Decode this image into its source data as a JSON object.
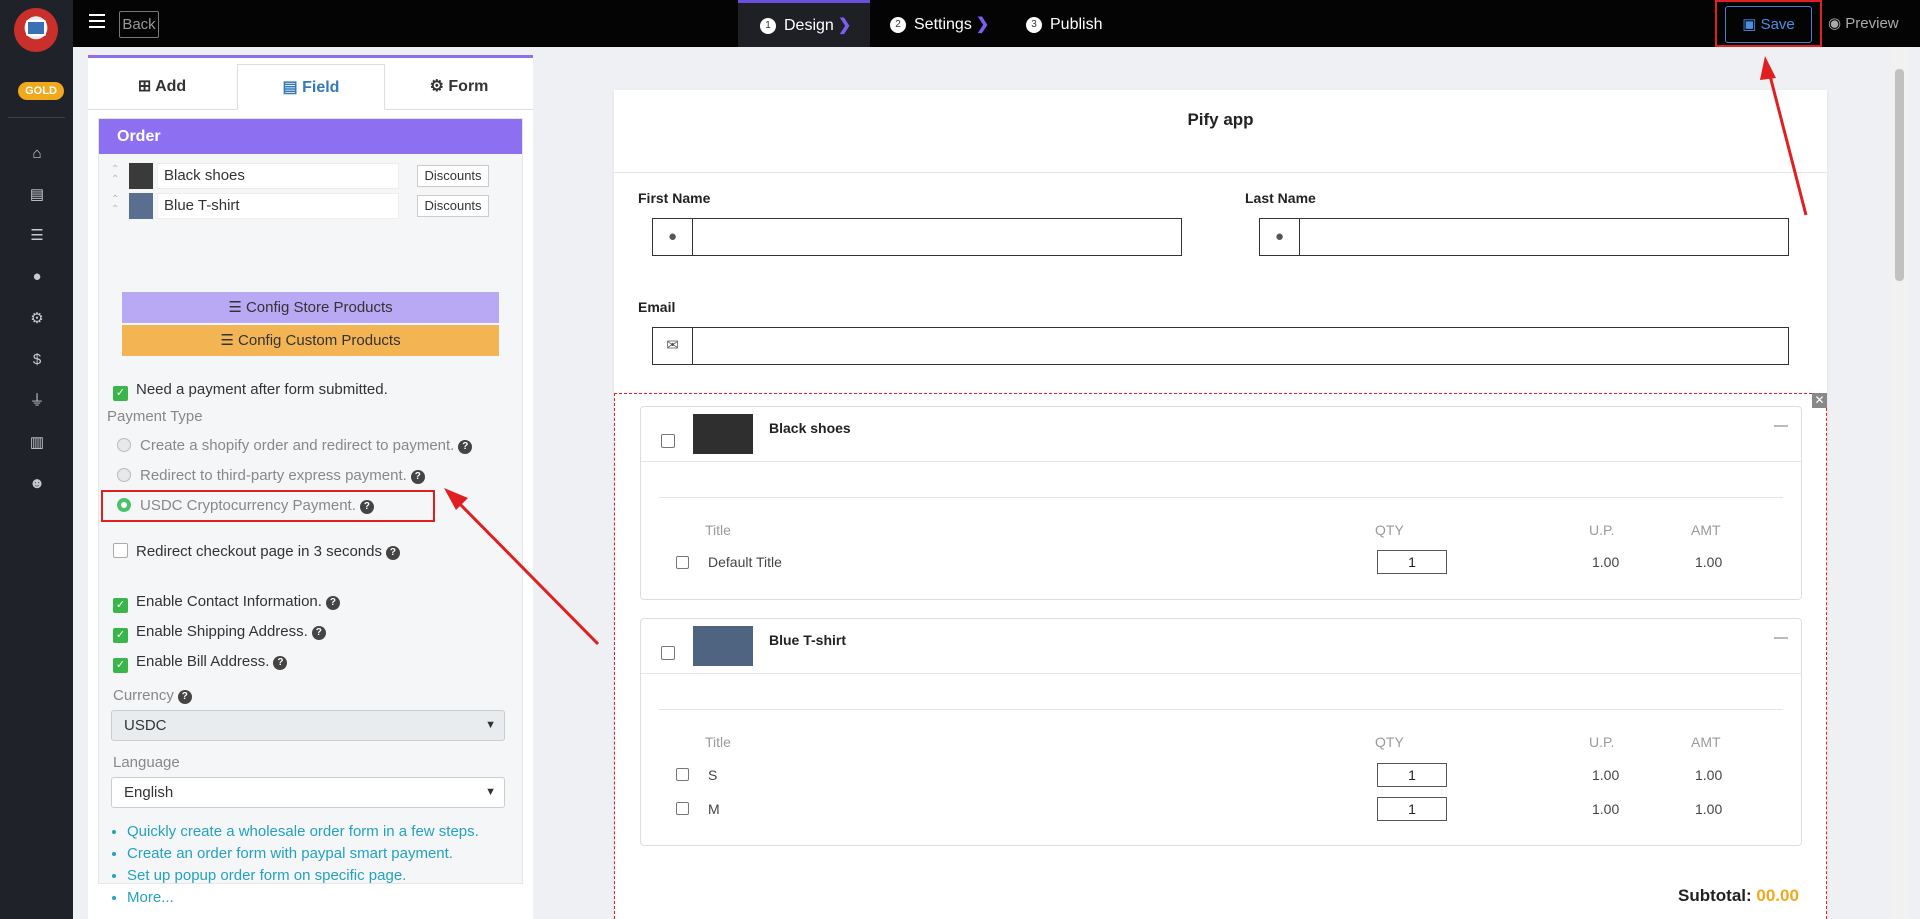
{
  "topbar": {
    "back_label": "Back",
    "steps": [
      {
        "num": "1",
        "label": "Design"
      },
      {
        "num": "2",
        "label": "Settings"
      },
      {
        "num": "3",
        "label": "Publish"
      }
    ],
    "save_label": "Save",
    "preview_label": "Preview"
  },
  "rail": {
    "badge": "GOLD"
  },
  "panel": {
    "tabs": {
      "add": "Add",
      "field": "Field",
      "form": "Form"
    },
    "section_title": "Order",
    "products": [
      {
        "name": "Black shoes",
        "discounts": "Discounts"
      },
      {
        "name": "Blue T-shirt",
        "discounts": "Discounts"
      }
    ],
    "config_store": "Config Store Products",
    "config_custom": "Config Custom Products",
    "need_payment": "Need a payment after form submitted.",
    "payment_type_label": "Payment Type",
    "payment_options": [
      {
        "label": "Create a shopify order and redirect to payment."
      },
      {
        "label": "Redirect to third-party express payment."
      },
      {
        "label": "USDC Cryptocurrency Payment."
      }
    ],
    "redirect_checkout": "Redirect checkout page in 3 seconds",
    "enable_contact": "Enable Contact Information.",
    "enable_shipping": "Enable Shipping Address.",
    "enable_bill": "Enable Bill Address.",
    "currency_label": "Currency",
    "currency_value": "USDC",
    "language_label": "Language",
    "language_value": "English",
    "links": [
      "Quickly create a wholesale order form in a few steps.",
      "Create an order form with paypal smart payment.",
      "Set up popup order form on specific page.",
      "More..."
    ]
  },
  "form": {
    "title": "Pify app",
    "first_name": "First Name",
    "last_name": "Last Name",
    "email": "Email",
    "columns": {
      "title": "Title",
      "qty": "QTY",
      "up": "U.P.",
      "amt": "AMT"
    },
    "products": [
      {
        "name": "Black shoes",
        "variants": [
          {
            "title": "Default Title",
            "qty": "1",
            "up": "1.00",
            "amt": "1.00"
          }
        ]
      },
      {
        "name": "Blue T-shirt",
        "variants": [
          {
            "title": "S",
            "qty": "1",
            "up": "1.00",
            "amt": "1.00"
          },
          {
            "title": "M",
            "qty": "1",
            "up": "1.00",
            "amt": "1.00"
          }
        ]
      }
    ],
    "subtotal_label": "Subtotal:",
    "subtotal_value": "00.00",
    "accent_color": "#f0a81d"
  }
}
